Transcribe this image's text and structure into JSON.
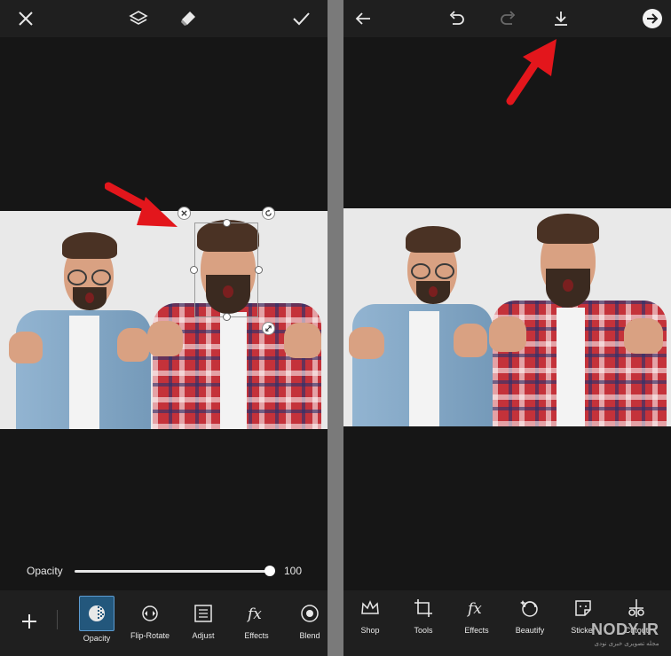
{
  "left_panel": {
    "top_icons": [
      "close-icon",
      "layers-icon",
      "eraser-icon",
      "check-icon"
    ],
    "opacity": {
      "label": "Opacity",
      "value": "100",
      "level_percent": 100
    },
    "tools": [
      {
        "label": "Opacity",
        "icon": "opacity-icon",
        "active": true
      },
      {
        "label": "Flip-Rotate",
        "icon": "flip-rotate-icon",
        "active": false
      },
      {
        "label": "Adjust",
        "icon": "adjust-icon",
        "active": false
      },
      {
        "label": "Effects",
        "icon": "fx-icon",
        "active": false
      },
      {
        "label": "Blend",
        "icon": "blend-icon",
        "active": false
      }
    ],
    "add_button": "plus-icon"
  },
  "right_panel": {
    "top_icons": [
      "back-arrow-icon",
      "undo-icon",
      "redo-icon",
      "download-icon",
      "next-arrow-icon"
    ],
    "tools": [
      {
        "label": "Shop",
        "icon": "crown-icon"
      },
      {
        "label": "Tools",
        "icon": "crop-icon"
      },
      {
        "label": "Effects",
        "icon": "fx-icon"
      },
      {
        "label": "Beautify",
        "icon": "beautify-icon"
      },
      {
        "label": "Sticker",
        "icon": "sticker-icon"
      },
      {
        "label": "Cutout",
        "icon": "cutout-icon"
      }
    ]
  },
  "watermark": {
    "main": "NODY.IR",
    "sub": "مجله تصویری خبری نودی"
  },
  "colors": {
    "panel_bg": "#161616",
    "bar_bg": "#1f1f1f",
    "accent": "#23577c",
    "arrow_red": "#e3161c",
    "separator": "#7a7a7a"
  }
}
